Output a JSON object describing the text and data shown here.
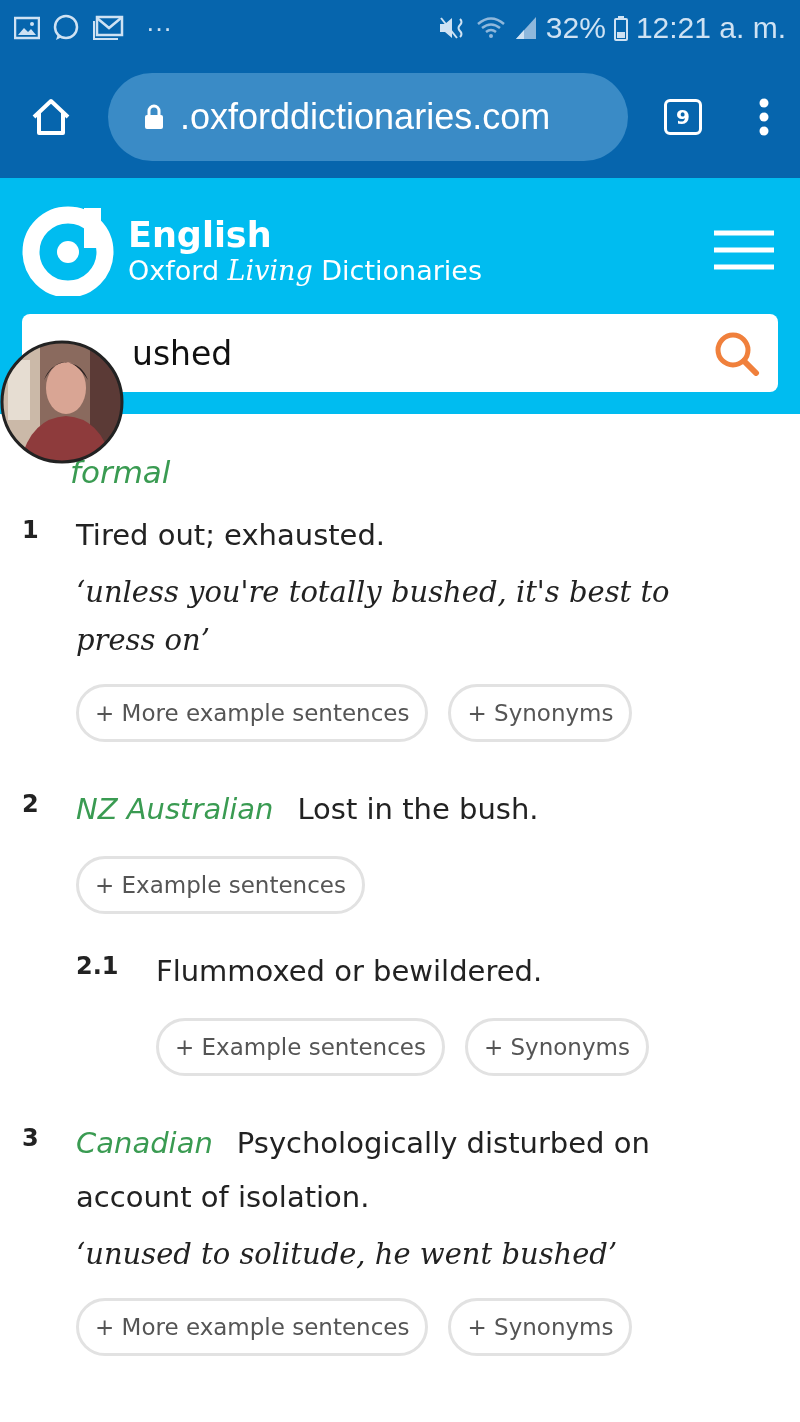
{
  "status_bar": {
    "more": "···",
    "battery": "32%",
    "time": "12:21 a. m."
  },
  "browser": {
    "url": ".oxforddictionaries.com",
    "tab_count": "9"
  },
  "site": {
    "title": "English",
    "subtitle_before": "Oxford",
    "subtitle_script": "Living",
    "subtitle_after": "Dictionaries",
    "search_value": "ushed"
  },
  "register_label": "formal",
  "senses": [
    {
      "number": "1",
      "definition": "Tired out; exhausted.",
      "example": "‘unless you're totally bushed, it's best to press on’",
      "buttons": [
        "+ More example sentences",
        "+ Synonyms"
      ],
      "sub": false
    },
    {
      "number": "2",
      "region": "NZ Australian",
      "definition": "Lost in the bush.",
      "buttons": [
        "+ Example sentences"
      ],
      "sub": false
    },
    {
      "number": "2.1",
      "definition": "Flummoxed or bewildered.",
      "buttons": [
        "+ Example sentences",
        "+ Synonyms"
      ],
      "sub": true
    },
    {
      "number": "3",
      "region": "Canadian",
      "definition": "Psychologically disturbed on account of isolation.",
      "example": "‘unused to solitude, he went bushed’",
      "buttons": [
        "+ More example sentences",
        "+ Synonyms"
      ],
      "sub": false
    }
  ]
}
